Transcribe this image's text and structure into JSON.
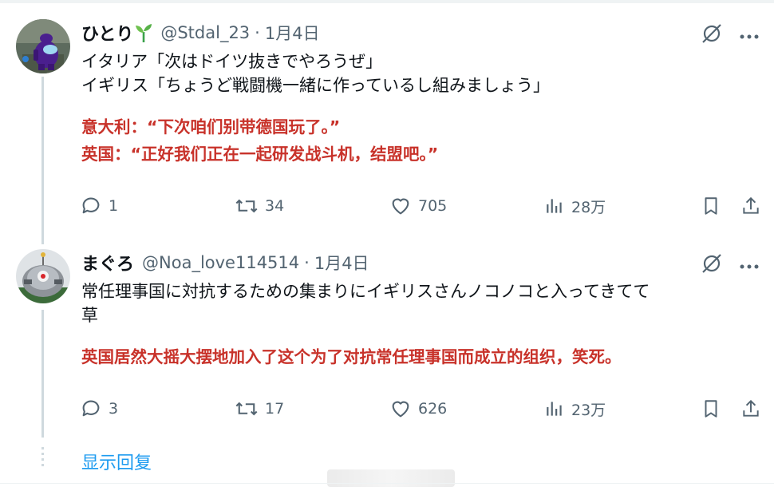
{
  "tweets": [
    {
      "display_name": "ひとり",
      "handle": "@Stdal_23",
      "separator": "·",
      "date": "1月4日",
      "text_lines": [
        "イタリア「次はドイツ抜きでやろうぜ」",
        "イギリス「ちょうど戦闘機一緒に作っているし組みましょう」"
      ],
      "translation_lines": [
        "意大利：“下次咱们别带德国玩了。”",
        "英国：“正好我们正在一起研发战斗机，结盟吧。”"
      ],
      "replies": "1",
      "retweets": "34",
      "likes": "705",
      "views": "28万"
    },
    {
      "display_name": "まぐろ",
      "handle": "@Noa_love114514",
      "separator": "·",
      "date": "1月4日",
      "text_lines": [
        "常任理事国に対抗するための集まりにイギリスさんノコノコと入ってきてて",
        "草"
      ],
      "translation_lines": [
        "英国居然大摇大摆地加入了这个为了对抗常任理事国而成立的组织，笑死。"
      ],
      "replies": "3",
      "retweets": "17",
      "likes": "626",
      "views": "23万"
    }
  ],
  "show_replies_label": "显示回复",
  "colors": {
    "accent": "#1d9bf0",
    "translation": "#c8322a",
    "muted": "#536471"
  }
}
